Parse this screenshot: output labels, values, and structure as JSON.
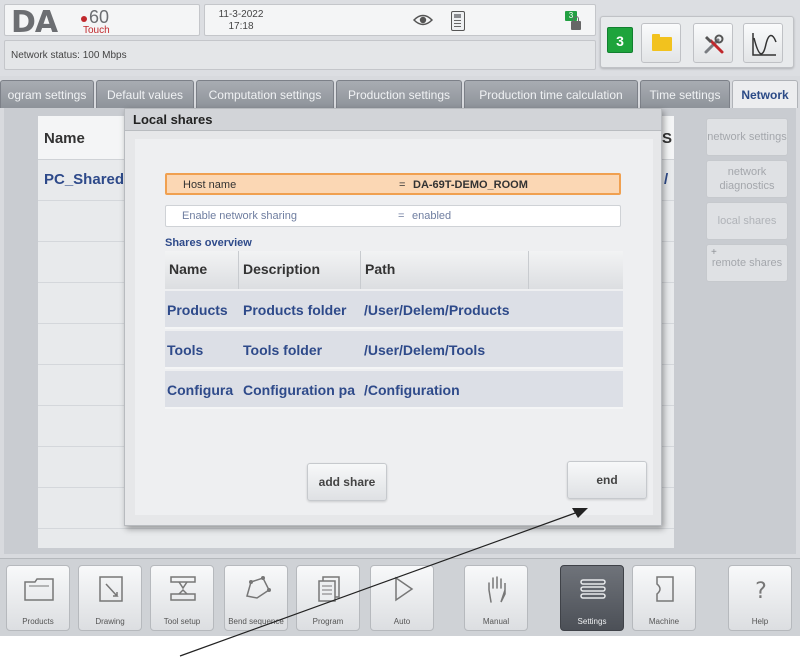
{
  "header": {
    "logo": {
      "brand": "DA",
      "model": "60",
      "edition": "Touch"
    },
    "date": "11-3-2022",
    "time": "17:18",
    "network_status": "Network status: 100 Mbps",
    "lock_badge": "3",
    "counter_badge": "3",
    "icons": [
      "eye-icon",
      "calculator-icon",
      "lock-icon",
      "folder-icon",
      "tools-icon",
      "waveform-icon"
    ]
  },
  "tabs": [
    {
      "label": "ogram settings",
      "active": false
    },
    {
      "label": "Default values",
      "active": false
    },
    {
      "label": "Computation settings",
      "active": false
    },
    {
      "label": "Production settings",
      "active": false
    },
    {
      "label": "Production time calculation",
      "active": false
    },
    {
      "label": "Time settings",
      "active": false
    },
    {
      "label": "Network",
      "active": true
    }
  ],
  "list": {
    "header_name": "Name",
    "header_right": "S",
    "rows": [
      {
        "name": "PC_Shared",
        "right": "/"
      }
    ]
  },
  "side_buttons": [
    {
      "label": "network settings"
    },
    {
      "label": "network diagnostics"
    },
    {
      "label": "local shares"
    },
    {
      "label": "remote shares",
      "prefix": "+"
    }
  ],
  "dialog": {
    "title": "Local shares",
    "fields": [
      {
        "label": "Host name",
        "eq": "=",
        "value": "DA-69T-DEMO_ROOM",
        "highlighted": true
      },
      {
        "label": "Enable network sharing",
        "eq": "=",
        "value": "enabled",
        "highlighted": false
      }
    ],
    "shares_title": "Shares overview",
    "columns": [
      "Name",
      "Description",
      "Path",
      ""
    ],
    "rows": [
      {
        "name": "Products",
        "description": "Products folder",
        "path": "/User/Delem/Products"
      },
      {
        "name": "Tools",
        "description": "Tools folder",
        "path": "/User/Delem/Tools"
      },
      {
        "name": "Configura",
        "description": "Configuration pa",
        "path": "/Configuration"
      }
    ],
    "add_button": "add share",
    "end_button": "end"
  },
  "bottom_nav": [
    {
      "label": "Products",
      "icon": "products-icon",
      "active": false
    },
    {
      "label": "Drawing",
      "icon": "drawing-icon",
      "active": false
    },
    {
      "label": "Tool setup",
      "icon": "tool-setup-icon",
      "active": false
    },
    {
      "label": "Bend sequence",
      "icon": "bend-sequence-icon",
      "active": false
    },
    {
      "label": "Program",
      "icon": "program-icon",
      "active": false
    },
    {
      "label": "Auto",
      "icon": "auto-icon",
      "active": false
    },
    {
      "label": "Manual",
      "icon": "manual-icon",
      "active": false
    },
    {
      "label": "Settings",
      "icon": "settings-icon",
      "active": true
    },
    {
      "label": "Machine",
      "icon": "machine-icon",
      "active": false
    },
    {
      "label": "Help",
      "icon": "help-icon",
      "active": false
    }
  ],
  "colors": {
    "accent_text": "#2e4a8a",
    "highlight_field": "#fbd7b4",
    "highlight_border": "#f0a050",
    "badge_green": "#1ea43c",
    "logo_red": "#c0282c"
  }
}
